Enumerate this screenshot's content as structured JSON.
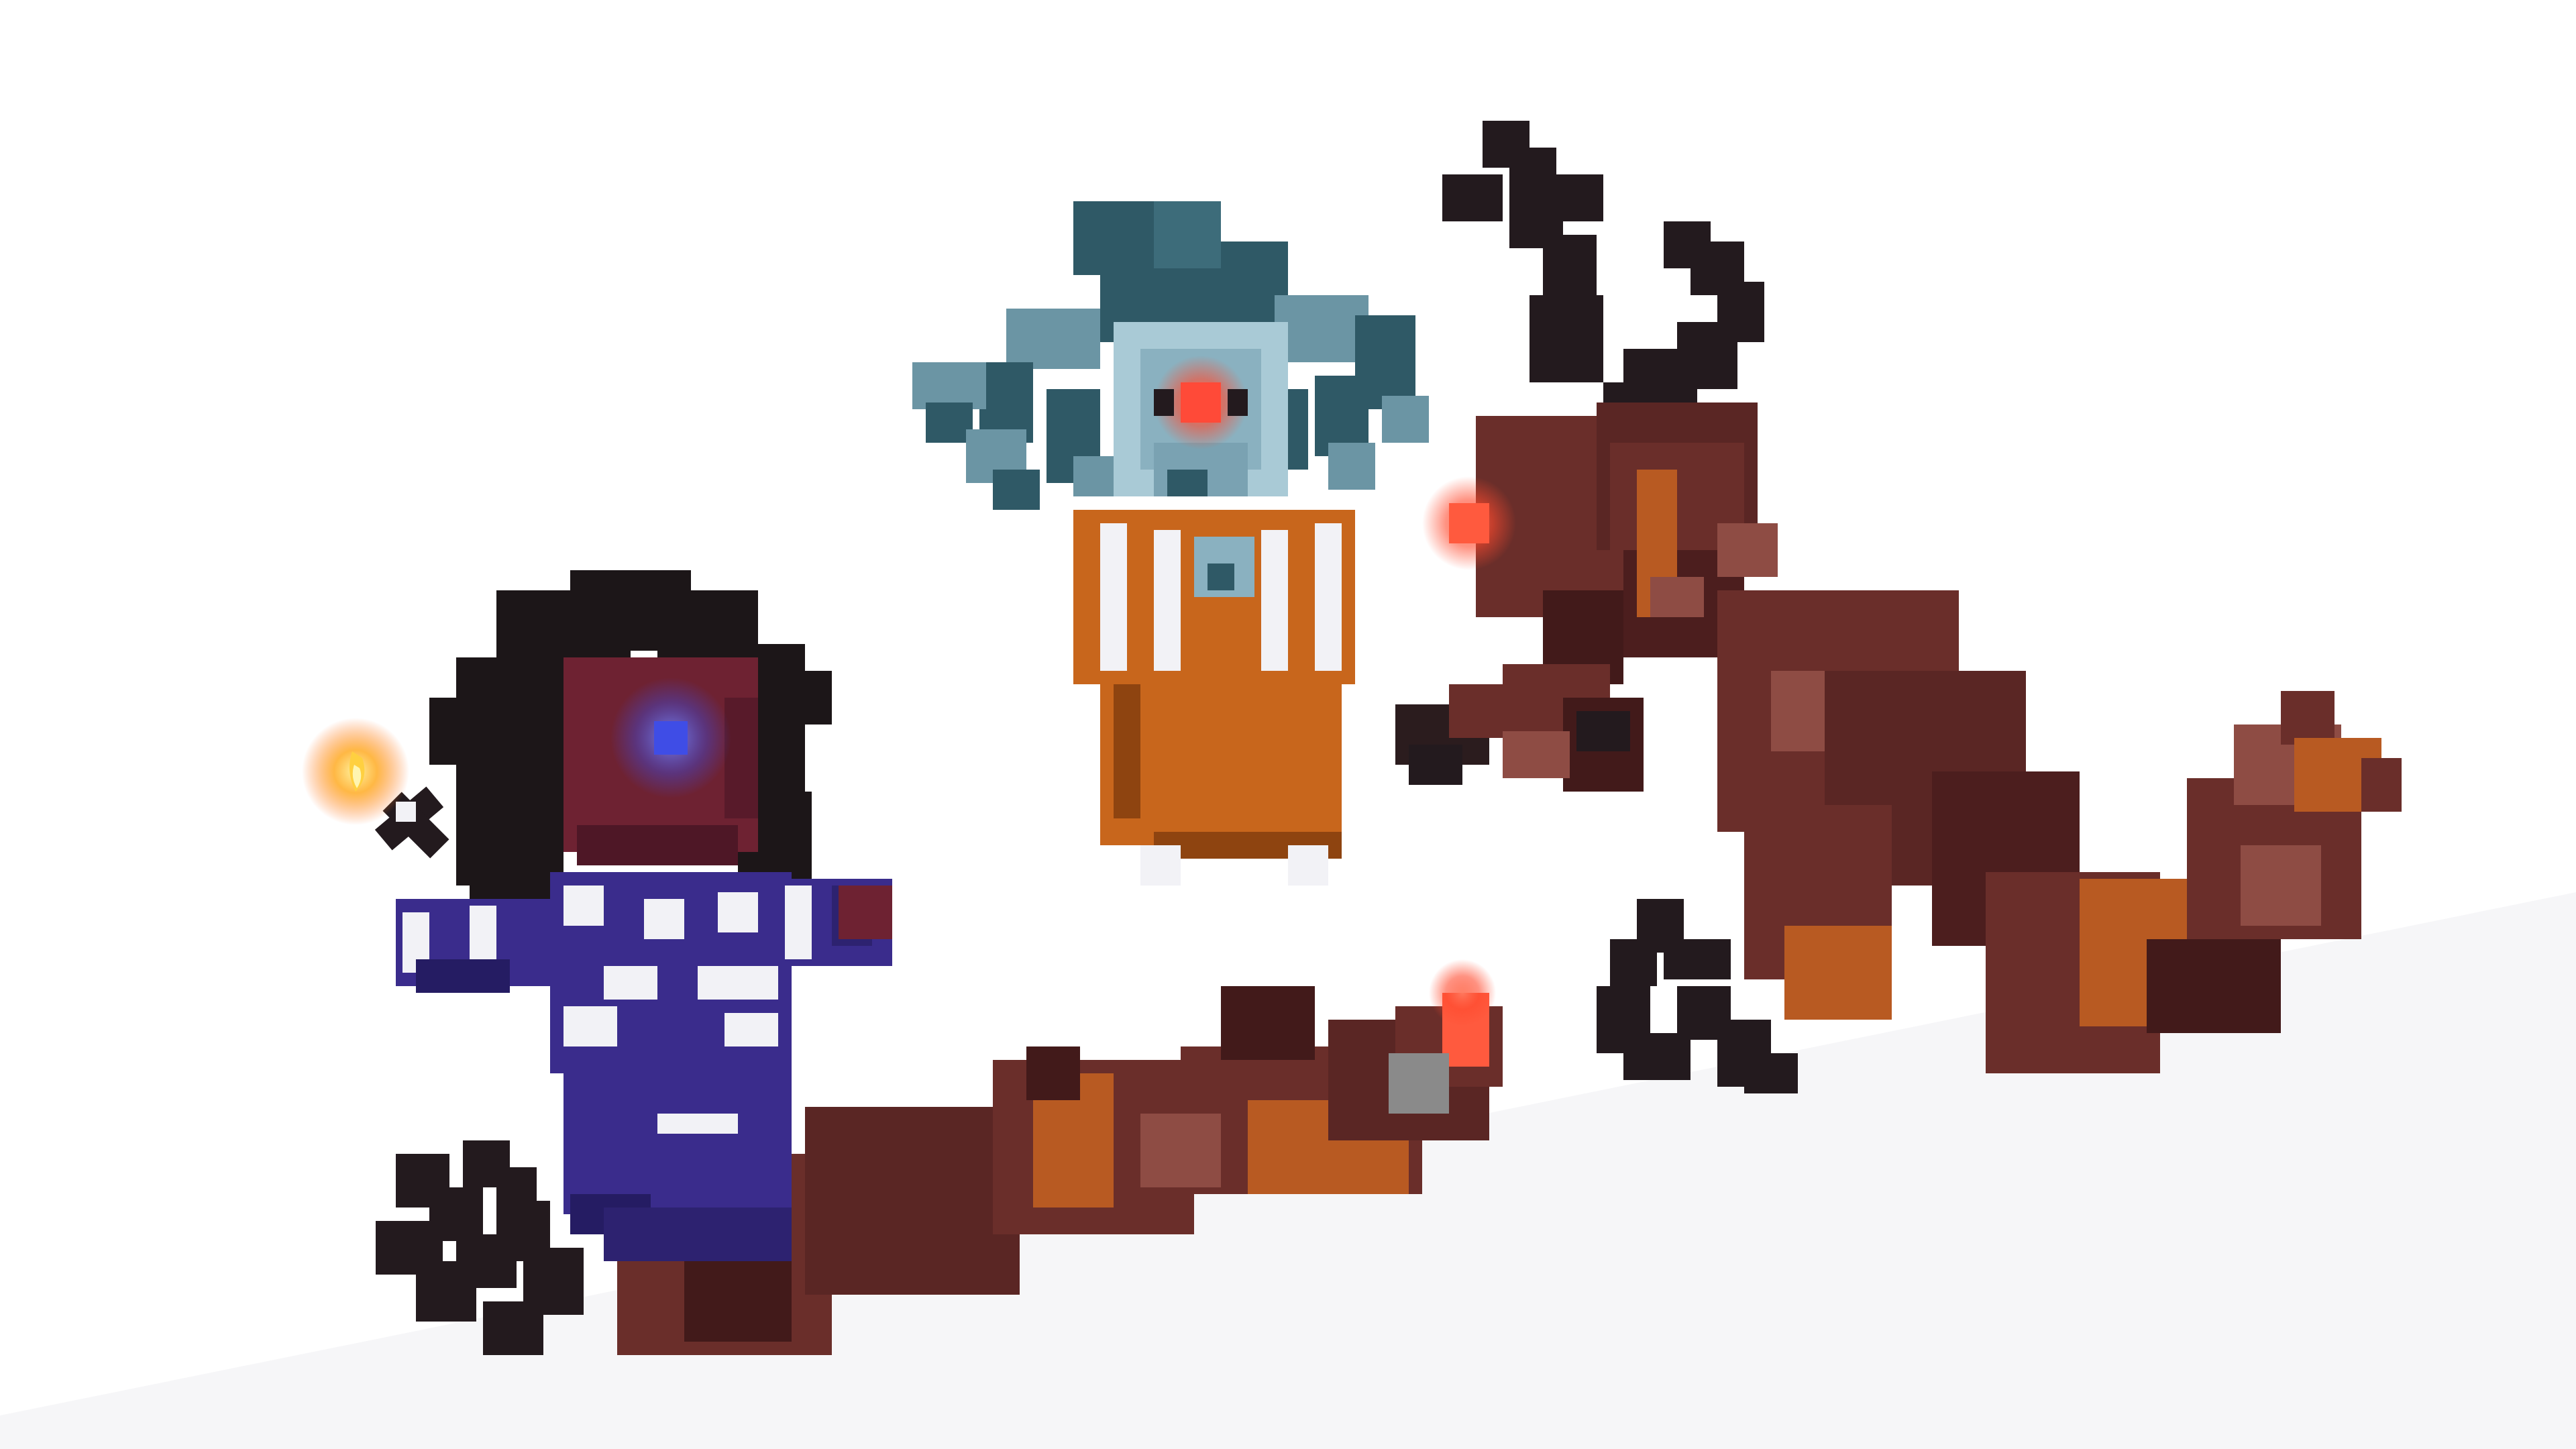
{
  "scene": {
    "colors": {
      "background": "#ffffff",
      "ground": "#f3f3f5",
      "hair": "#1c1618",
      "skin": "#6e2232",
      "skin_dark": "#4e1726",
      "eye_glow": "#3f4de6",
      "shirt": "#3a2c8c",
      "shirt_dark": "#251c63",
      "stripe": "#f2f2f6",
      "flame": "#ffb030",
      "doll_body": "#c8661c",
      "doll_body_dark": "#8e4410",
      "doll_head": "#a9cad6",
      "doll_hair": "#2f5966",
      "doll_eye": "#ff4a38",
      "monster": "#6a2e2a",
      "monster_dark": "#421a1a",
      "monster_light": "#8e4c44",
      "monster_orange": "#b85a22",
      "monster_antler": "#231a1e",
      "monster_glow": "#ff4a2e",
      "gray_block": "#8a8a8a"
    },
    "icons": {
      "lighter": "lighter-icon",
      "flame": "flame-icon",
      "sunflower_eye": "glowing-eye-icon"
    }
  }
}
